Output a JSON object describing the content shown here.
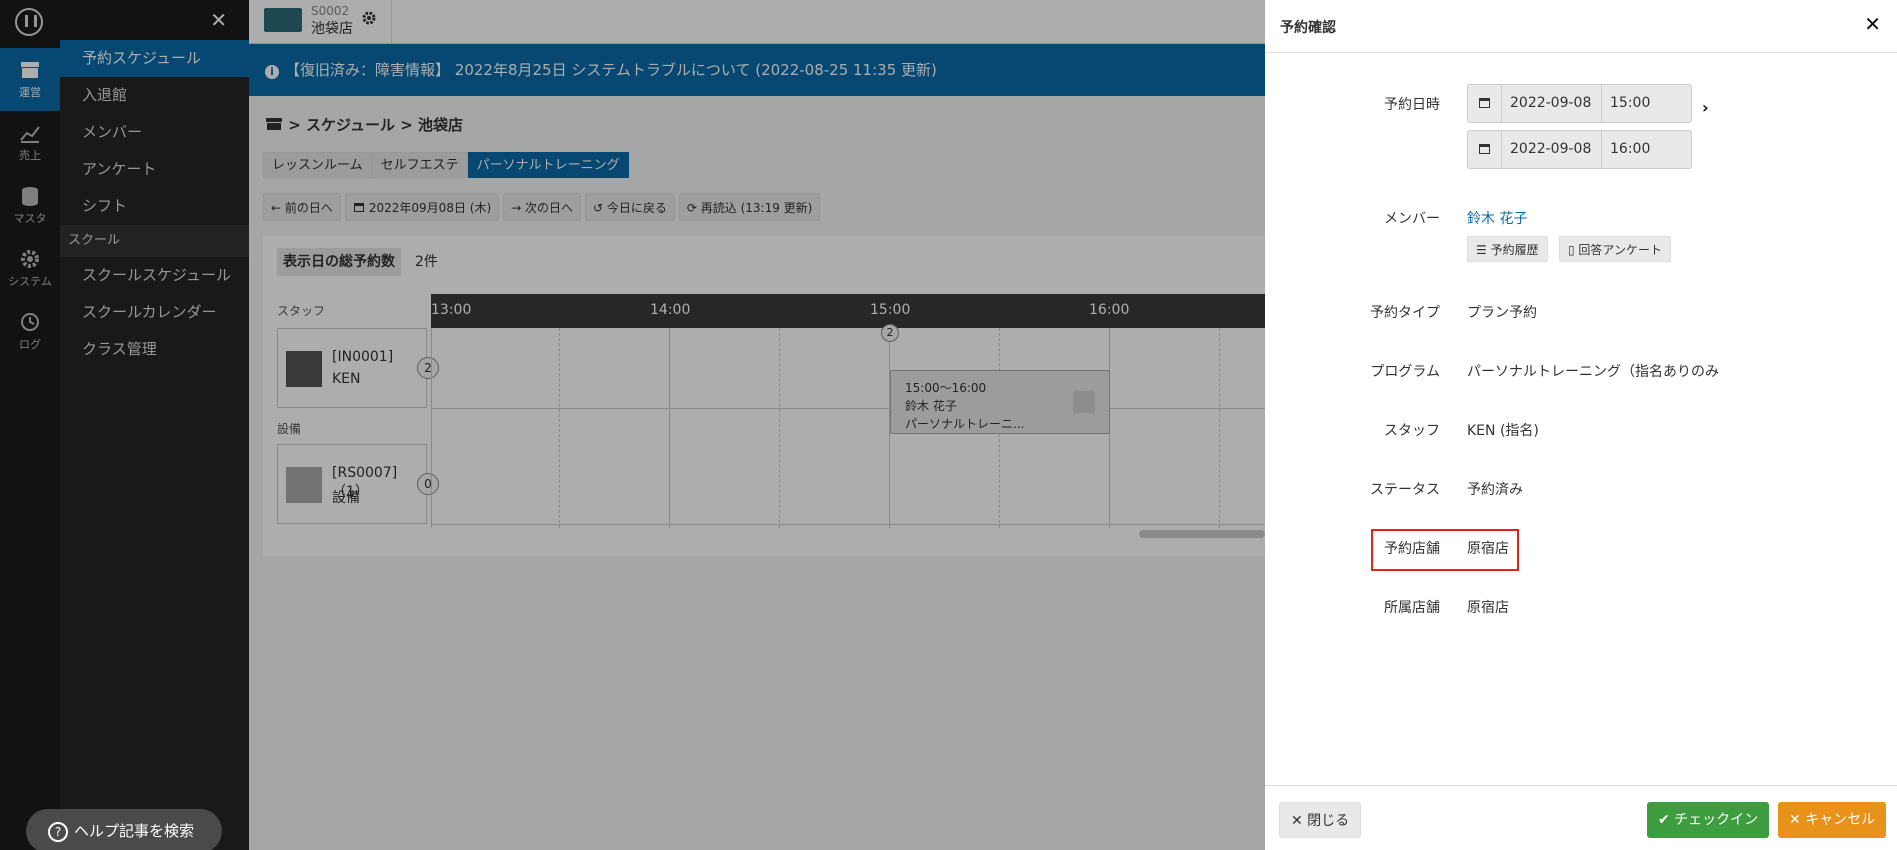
{
  "rail": {
    "items": [
      {
        "label": "運営",
        "icon": "store-icon"
      },
      {
        "label": "売上",
        "icon": "chart-icon"
      },
      {
        "label": "マスタ",
        "icon": "database-icon"
      },
      {
        "label": "システム",
        "icon": "gear-icon"
      },
      {
        "label": "ログ",
        "icon": "history-icon"
      }
    ]
  },
  "menu": {
    "close": "✕",
    "items": [
      "予約スケジュール",
      "入退館",
      "メンバー",
      "アンケート",
      "シフト"
    ],
    "section": "スクール",
    "school_items": [
      "スクールスケジュール",
      "スクールカレンダー",
      "クラス管理"
    ],
    "help": "ヘルプ記事を検索"
  },
  "header": {
    "store_code": "S0002",
    "store_name": "池袋店"
  },
  "notice": "【復旧済み：障害情報】 2022年8月25日 システムトラブルについて (2022-08-25 11:35 更新)",
  "breadcrumb": {
    "sep": ">",
    "schedule": "スケジュール",
    "store": "池袋店"
  },
  "tabs": [
    "レッスンルーム",
    "セルフエステ",
    "パーソナルトレーニング"
  ],
  "toolbar": {
    "prev": "← 前の日へ",
    "date": "2022年09月08日 (木)",
    "next": "→ 次の日へ",
    "today": "↺ 今日に戻る",
    "reload": "再読込 (13:19 更新)"
  },
  "schedule": {
    "total_label": "表示日の総予約数",
    "total_value": "2件",
    "staff_label": "スタッフ",
    "equip_label": "設備",
    "staff": {
      "code": "[IN0001]",
      "name": "KEN",
      "count": "2"
    },
    "equip": {
      "code": "[RS0007]（1）",
      "name": "設備",
      "count": "0"
    },
    "times": [
      "13:00",
      "14:00",
      "15:00",
      "16:00"
    ],
    "booking": {
      "badge": "2",
      "time": "15:00〜16:00",
      "member": "鈴木 花子",
      "program": "パーソナルトレーニ..."
    }
  },
  "modal": {
    "title": "予約確認",
    "close_x": "✕",
    "datetime_label": "予約日時",
    "start_date": "2022-09-08",
    "start_time": "15:00",
    "end_date": "2022-09-08",
    "end_time": "16:00",
    "chevron": "›",
    "member_label": "メンバー",
    "member_name": "鈴木 花子",
    "history_btn": "予約履歴",
    "survey_btn": "回答アンケート",
    "type_label": "予約タイプ",
    "type_value": "プラン予約",
    "program_label": "プログラム",
    "program_value": "パーソナルトレーニング（指名ありのみ",
    "staff_label": "スタッフ",
    "staff_value": "KEN (指名)",
    "status_label": "ステータス",
    "status_value": "予約済み",
    "store_label": "予約店舗",
    "store_value": "原宿店",
    "home_store_label": "所属店舗",
    "home_store_value": "原宿店",
    "btn_close": "✕ 閉じる",
    "btn_checkin": "✔ チェックイン",
    "btn_cancel": "✕ キャンセル"
  }
}
